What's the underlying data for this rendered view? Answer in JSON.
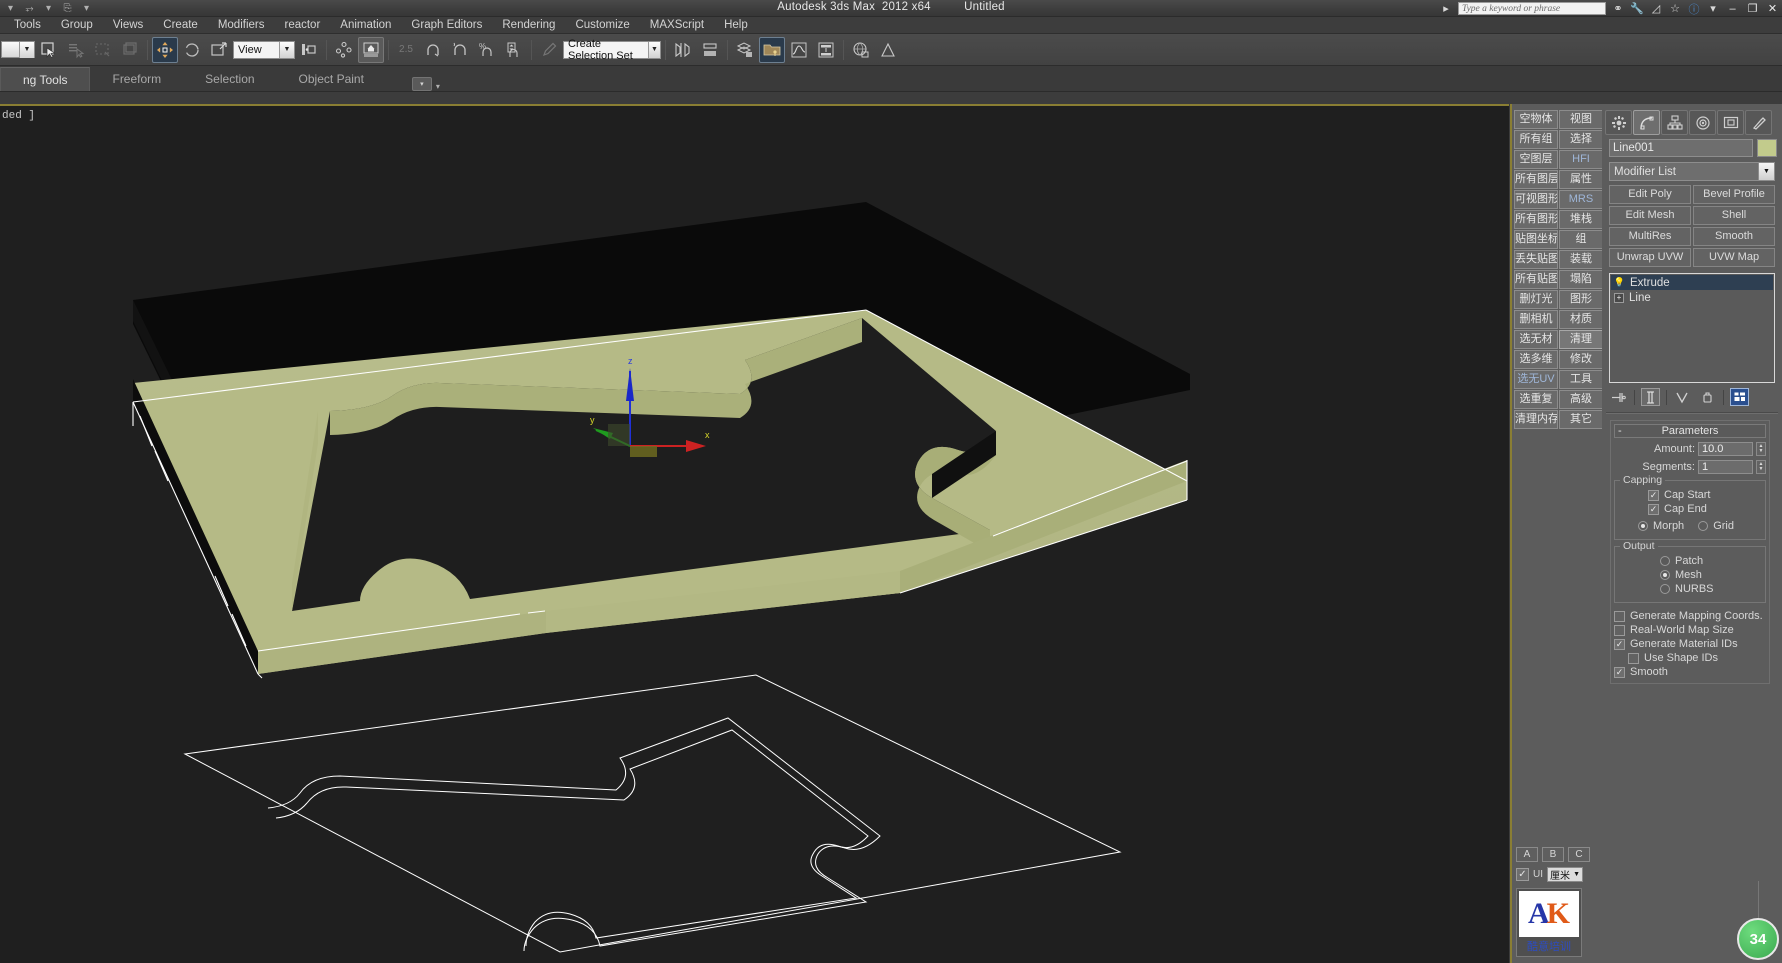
{
  "window": {
    "app_title": "Autodesk 3ds Max",
    "version": "2012 x64",
    "document": "Untitled",
    "quick_access": [
      "undo-arrow-icon",
      "redo-arrow-icon",
      "caret-down-icon",
      "new-scene-icon",
      "menu-caret-icon"
    ],
    "search_placeholder": "Type a keyword or phrase",
    "right_icons": [
      "binoculars-icon",
      "wrench-icon",
      "subscription-icon",
      "star-icon",
      "help-icon",
      "help-caret-icon"
    ],
    "controls": {
      "minimize": "–",
      "restore": "❐",
      "close": "✕"
    }
  },
  "menu": {
    "items": [
      "Tools",
      "Group",
      "Views",
      "Create",
      "Modifiers",
      "reactor",
      "Animation",
      "Graph Editors",
      "Rendering",
      "Customize",
      "MAXScript",
      "Help"
    ]
  },
  "toolbar": {
    "coordinate_system": "View",
    "selection_set": "Create Selection Set",
    "items": [
      {
        "name": "undo-dropdown",
        "icon": "▼",
        "state": "normal"
      },
      {
        "name": "select-object-icon",
        "icon": "⬚",
        "state": "normal"
      },
      {
        "name": "select-by-name-icon",
        "icon": "☰",
        "state": "dim"
      },
      {
        "name": "select-region-icon",
        "icon": "⬚",
        "state": "dim"
      },
      {
        "name": "window-crossing-icon",
        "icon": "▢",
        "state": "dim"
      },
      {
        "name": "select-and-move-icon",
        "icon": "✥",
        "state": "active"
      },
      {
        "name": "select-and-rotate-icon",
        "icon": "↻",
        "state": "normal"
      },
      {
        "name": "select-and-scale-icon",
        "icon": "↗",
        "state": "normal"
      },
      {
        "name": "use-pivot-center-icon",
        "icon": "⊞",
        "state": "normal"
      },
      {
        "name": "select-and-link-icon",
        "icon": "⚭",
        "state": "normal"
      },
      {
        "name": "named-selection-icon",
        "icon": "▲",
        "state": "active"
      },
      {
        "name": "snap-25-icon",
        "icon": "2.5",
        "state": "dim"
      },
      {
        "name": "angle-snap-icon",
        "icon": "∠",
        "state": "normal"
      },
      {
        "name": "percent-snap-icon",
        "icon": "%",
        "state": "normal"
      },
      {
        "name": "spinner-snap-icon",
        "icon": "↕",
        "state": "normal"
      },
      {
        "name": "edit-named-sets-icon",
        "icon": "✎",
        "state": "normal"
      },
      {
        "name": "mirror-icon",
        "icon": "▷◁",
        "state": "normal"
      },
      {
        "name": "align-icon",
        "icon": "≡",
        "state": "normal"
      },
      {
        "name": "layer-manager-icon",
        "icon": "≣",
        "state": "normal"
      },
      {
        "name": "curve-editor-icon",
        "icon": "∿",
        "state": "normal"
      },
      {
        "name": "schematic-view-icon",
        "icon": "⬒",
        "state": "normal"
      },
      {
        "name": "material-editor-icon",
        "icon": "◐",
        "state": "normal"
      },
      {
        "name": "render-setup-icon",
        "icon": "▣",
        "state": "normal"
      }
    ]
  },
  "ribbon": {
    "tabs": [
      "ng Tools",
      "Freeform",
      "Selection",
      "Object Paint"
    ],
    "active_tab": "ng Tools"
  },
  "viewport": {
    "label": "ded ]",
    "shading_color": "#b5ba86",
    "background": "#1f1f1f",
    "gizmo_axes": [
      "z",
      "y",
      "x"
    ],
    "gizmo_colors": {
      "z": "#2030d8",
      "y": "#22aa22",
      "x": "#d02020"
    },
    "selection_outline_color": "#ffffff"
  },
  "script_panel": {
    "buttons_col1": [
      "空物体",
      "所有组",
      "空图层",
      "所有图层",
      "可视图形",
      "所有图形",
      "贴图坐标",
      "丢失贴图",
      "所有贴图",
      "删灯光",
      "删相机",
      "选无材",
      "选多维",
      "选无UV",
      "选重复",
      "清理内存"
    ],
    "buttons_col2": [
      "视图",
      "选择",
      "HFI",
      "属性",
      "MRS",
      "堆栈",
      "组",
      "装载",
      "塌陷",
      "图形",
      "材质",
      "清理",
      "修改",
      "工具",
      "高级",
      "其它"
    ],
    "abc_buttons": [
      "A",
      "B",
      "C"
    ],
    "ui_checkbox_label": "UI",
    "ui_checkbox_checked": true,
    "units_value": "厘米",
    "logo_letters": {
      "a": "A",
      "k": "K"
    },
    "logo_caption": "酷意培训"
  },
  "command_panel": {
    "tabs": [
      {
        "name": "create-tab",
        "icon": "⚙"
      },
      {
        "name": "modify-tab",
        "icon": "⌒"
      },
      {
        "name": "hierarchy-tab",
        "icon": "⚬"
      },
      {
        "name": "motion-tab",
        "icon": "◎"
      },
      {
        "name": "display-tab",
        "icon": "▣"
      },
      {
        "name": "utilities-tab",
        "icon": "⚒"
      }
    ],
    "active_tab_index": 1,
    "object_name": "Line001",
    "object_color": "#c2cb8c",
    "modifier_list_label": "Modifier List",
    "modifier_buttons": [
      "Edit Poly",
      "Bevel Profile",
      "Edit Mesh",
      "Shell",
      "MultiRes",
      "Smooth",
      "Unwrap UVW",
      "UVW Map"
    ],
    "stack": [
      {
        "label": "Extrude",
        "selected": true,
        "icon": "lightbulb-icon"
      },
      {
        "label": "Line",
        "selected": false,
        "icon": "plus-icon"
      }
    ],
    "stack_tools": [
      "pin-stack-icon",
      "show-end-result-icon",
      "make-unique-icon",
      "remove-modifier-icon",
      "configure-sets-icon"
    ],
    "parameters": {
      "title": "Parameters",
      "collapse_glyph": "-",
      "amount_label": "Amount:",
      "amount_value": "10.0",
      "segments_label": "Segments:",
      "segments_value": "1",
      "capping": {
        "title": "Capping",
        "cap_start": {
          "label": "Cap Start",
          "checked": true
        },
        "cap_end": {
          "label": "Cap End",
          "checked": true
        },
        "morph": {
          "label": "Morph",
          "selected": true
        },
        "grid": {
          "label": "Grid",
          "selected": false
        }
      },
      "output": {
        "title": "Output",
        "patch": {
          "label": "Patch",
          "selected": false
        },
        "mesh": {
          "label": "Mesh",
          "selected": true
        },
        "nurbs": {
          "label": "NURBS",
          "selected": false
        }
      },
      "options": [
        {
          "label": "Generate Mapping Coords.",
          "checked": false,
          "indent": false
        },
        {
          "label": "Real-World Map Size",
          "checked": false,
          "indent": false
        },
        {
          "label": "Generate Material IDs",
          "checked": true,
          "indent": false
        },
        {
          "label": "Use Shape IDs",
          "checked": false,
          "indent": true
        },
        {
          "label": "Smooth",
          "checked": true,
          "indent": false
        }
      ]
    }
  },
  "overlay_badge": {
    "value": "34",
    "color": "#3aa94f"
  }
}
